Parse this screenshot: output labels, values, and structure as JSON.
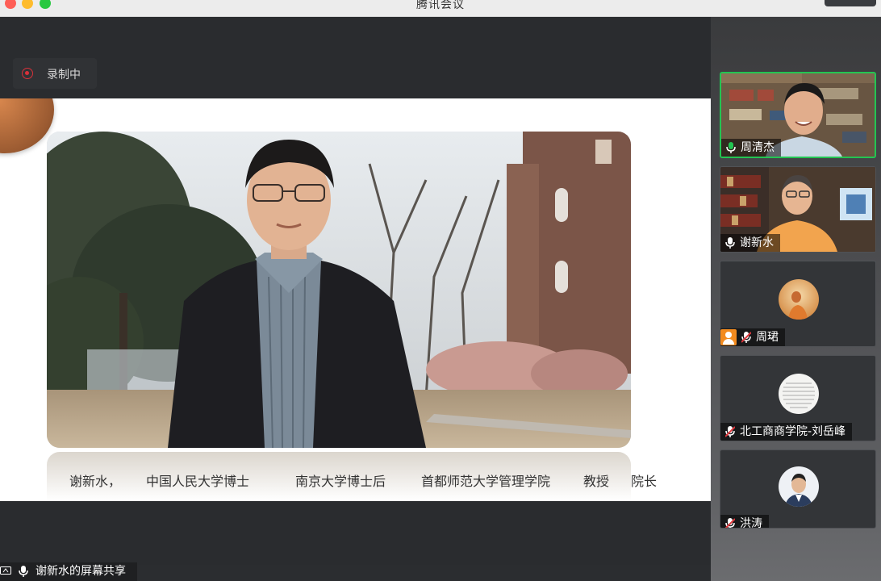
{
  "window": {
    "title": "腾讯会议"
  },
  "recording": {
    "label": "录制中"
  },
  "slide": {
    "caption": [
      "谢新水，",
      "中国人民大学博士",
      "南京大学博士后",
      "首都师范大学管理学院",
      "教授",
      "院长"
    ]
  },
  "participants": [
    {
      "name": "周清杰",
      "speaking": true,
      "muted": false,
      "video": true
    },
    {
      "name": "谢新水",
      "speaking": false,
      "muted": false,
      "video": true
    },
    {
      "name": "周珺",
      "speaking": false,
      "muted": true,
      "video": false,
      "host": true
    },
    {
      "name": "北工商商学院-刘岳峰",
      "speaking": false,
      "muted": true,
      "video": false
    },
    {
      "name": "洪涛",
      "speaking": false,
      "muted": true,
      "video": false
    }
  ],
  "share": {
    "label": "谢新水的屏幕共享"
  },
  "colors": {
    "active_speaker_border": "#23c552",
    "record_red": "#d9313a",
    "host_orange": "#f38b1f"
  }
}
